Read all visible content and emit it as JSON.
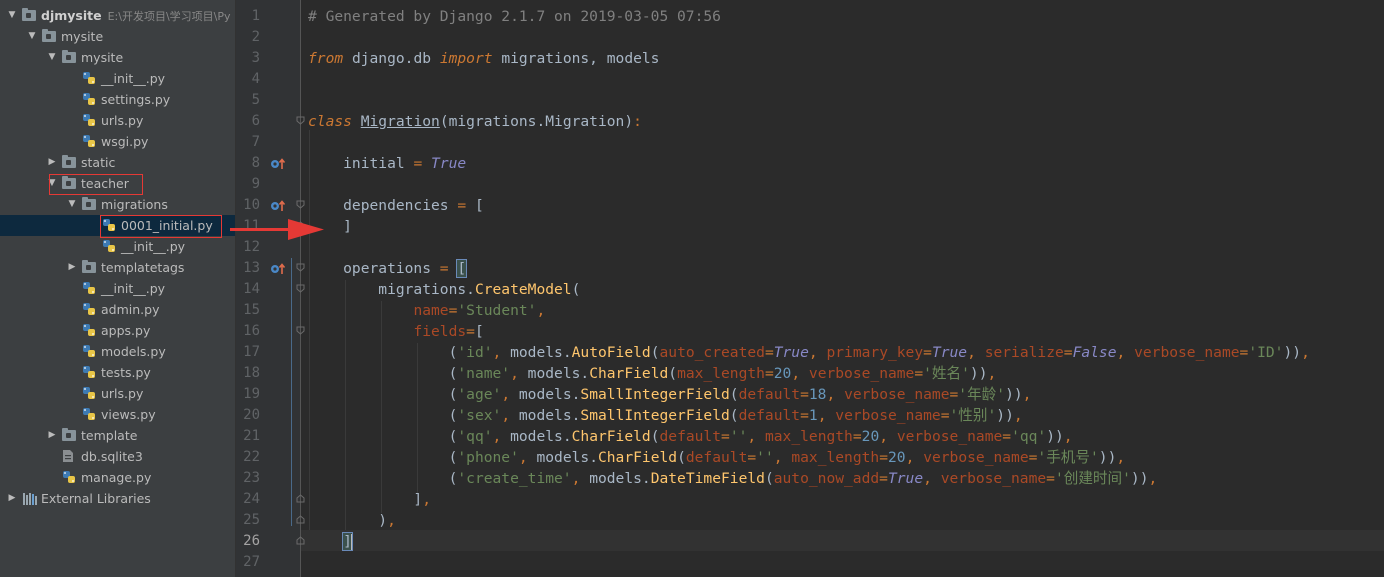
{
  "project_tree": {
    "rows": [
      {
        "label": "djmysite",
        "hint": "E:\\开发项目\\学习项目\\Py",
        "icon": "folder-icon",
        "expanded": true
      },
      {
        "label": "mysite",
        "icon": "folder-icon",
        "expanded": true
      },
      {
        "label": "mysite",
        "icon": "folder-icon",
        "expanded": true
      },
      {
        "label": "__init__.py",
        "icon": "python-file-icon"
      },
      {
        "label": "settings.py",
        "icon": "python-file-icon"
      },
      {
        "label": "urls.py",
        "icon": "python-file-icon"
      },
      {
        "label": "wsgi.py",
        "icon": "python-file-icon"
      },
      {
        "label": "static",
        "icon": "folder-icon",
        "expanded": false
      },
      {
        "label": "teacher",
        "icon": "folder-icon",
        "expanded": true,
        "highlighted": true
      },
      {
        "label": "migrations",
        "icon": "folder-icon",
        "expanded": true
      },
      {
        "label": "0001_initial.py",
        "icon": "python-file-icon",
        "selected": true,
        "highlighted": true
      },
      {
        "label": "__init__.py",
        "icon": "python-file-icon"
      },
      {
        "label": "templatetags",
        "icon": "folder-icon",
        "expanded": false
      },
      {
        "label": "__init__.py",
        "icon": "python-file-icon"
      },
      {
        "label": "admin.py",
        "icon": "python-file-icon"
      },
      {
        "label": "apps.py",
        "icon": "python-file-icon"
      },
      {
        "label": "models.py",
        "icon": "python-file-icon"
      },
      {
        "label": "tests.py",
        "icon": "python-file-icon"
      },
      {
        "label": "urls.py",
        "icon": "python-file-icon"
      },
      {
        "label": "views.py",
        "icon": "python-file-icon"
      },
      {
        "label": "template",
        "icon": "folder-icon",
        "expanded": false
      },
      {
        "label": "db.sqlite3",
        "icon": "database-file-icon"
      },
      {
        "label": "manage.py",
        "icon": "python-file-icon"
      },
      {
        "label": "External Libraries",
        "icon": "library-icon",
        "expanded": false
      }
    ]
  },
  "editor": {
    "current_line": 26,
    "annotation_color": "#e53935",
    "lines": [
      {
        "n": "1",
        "tokens": [
          [
            "c-com",
            "# Generated by Django 2.1.7 on 2019-03-05 07:56"
          ]
        ]
      },
      {
        "n": "2",
        "tokens": []
      },
      {
        "n": "3",
        "tokens": [
          [
            "c-kwi",
            "from"
          ],
          [
            "c-pl",
            " django.db "
          ],
          [
            "c-kwi",
            "import"
          ],
          [
            "c-pl",
            " migrations, models"
          ]
        ]
      },
      {
        "n": "4",
        "tokens": []
      },
      {
        "n": "5",
        "tokens": []
      },
      {
        "n": "6",
        "tokens": [
          [
            "c-kwi",
            "class"
          ],
          [
            "c-pl",
            " "
          ],
          [
            "c-cls",
            "Migration"
          ],
          [
            "c-pl",
            "(migrations.Migration)"
          ],
          [
            "c-kw",
            ":"
          ]
        ]
      },
      {
        "n": "7",
        "tokens": []
      },
      {
        "n": "8",
        "tokens": [
          [
            "c-pl",
            "    initial "
          ],
          [
            "c-kw",
            "="
          ],
          [
            "c-pl",
            " "
          ],
          [
            "c-bool",
            "True"
          ]
        ]
      },
      {
        "n": "9",
        "tokens": []
      },
      {
        "n": "10",
        "tokens": [
          [
            "c-pl",
            "    dependencies "
          ],
          [
            "c-kw",
            "="
          ],
          [
            "c-pl",
            " ["
          ]
        ]
      },
      {
        "n": "11",
        "tokens": [
          [
            "c-pl",
            "    ]"
          ]
        ]
      },
      {
        "n": "12",
        "tokens": []
      },
      {
        "n": "13",
        "tokens": [
          [
            "c-pl",
            "    operations "
          ],
          [
            "c-kw",
            "="
          ],
          [
            "c-pl",
            " "
          ],
          [
            "brace",
            "["
          ]
        ]
      },
      {
        "n": "14",
        "tokens": [
          [
            "c-pl",
            "        migrations."
          ],
          [
            "c-fn",
            "CreateModel"
          ],
          [
            "c-pl",
            "("
          ]
        ]
      },
      {
        "n": "15",
        "tokens": [
          [
            "c-pl",
            "            "
          ],
          [
            "c-prm",
            "name"
          ],
          [
            "c-kw",
            "="
          ],
          [
            "c-str",
            "'Student'"
          ],
          [
            "c-kw",
            ","
          ]
        ]
      },
      {
        "n": "16",
        "tokens": [
          [
            "c-pl",
            "            "
          ],
          [
            "c-prm",
            "fields"
          ],
          [
            "c-kw",
            "="
          ],
          [
            "c-pl",
            "["
          ]
        ]
      },
      {
        "n": "17",
        "tokens": [
          [
            "c-pl",
            "                ("
          ],
          [
            "c-str",
            "'id'"
          ],
          [
            "c-kw",
            ","
          ],
          [
            "c-pl",
            " models."
          ],
          [
            "c-fn",
            "AutoField"
          ],
          [
            "c-pl",
            "("
          ],
          [
            "c-prm",
            "auto_created"
          ],
          [
            "c-kw",
            "="
          ],
          [
            "c-bool",
            "True"
          ],
          [
            "c-kw",
            ","
          ],
          [
            "c-pl",
            " "
          ],
          [
            "c-prm",
            "primary_key"
          ],
          [
            "c-kw",
            "="
          ],
          [
            "c-bool",
            "True"
          ],
          [
            "c-kw",
            ","
          ],
          [
            "c-pl",
            " "
          ],
          [
            "c-prm",
            "serialize"
          ],
          [
            "c-kw",
            "="
          ],
          [
            "c-bool",
            "False"
          ],
          [
            "c-kw",
            ","
          ],
          [
            "c-pl",
            " "
          ],
          [
            "c-prm",
            "verbose_name"
          ],
          [
            "c-kw",
            "="
          ],
          [
            "c-str",
            "'ID'"
          ],
          [
            "c-pl",
            "))"
          ],
          [
            "c-kw",
            ","
          ]
        ]
      },
      {
        "n": "18",
        "tokens": [
          [
            "c-pl",
            "                ("
          ],
          [
            "c-str",
            "'name'"
          ],
          [
            "c-kw",
            ","
          ],
          [
            "c-pl",
            " models."
          ],
          [
            "c-fn",
            "CharField"
          ],
          [
            "c-pl",
            "("
          ],
          [
            "c-prm",
            "max_length"
          ],
          [
            "c-kw",
            "="
          ],
          [
            "c-num",
            "20"
          ],
          [
            "c-kw",
            ","
          ],
          [
            "c-pl",
            " "
          ],
          [
            "c-prm",
            "verbose_name"
          ],
          [
            "c-kw",
            "="
          ],
          [
            "c-str",
            "'姓名'"
          ],
          [
            "c-pl",
            "))"
          ],
          [
            "c-kw",
            ","
          ]
        ]
      },
      {
        "n": "19",
        "tokens": [
          [
            "c-pl",
            "                ("
          ],
          [
            "c-str",
            "'age'"
          ],
          [
            "c-kw",
            ","
          ],
          [
            "c-pl",
            " models."
          ],
          [
            "c-fn",
            "SmallIntegerField"
          ],
          [
            "c-pl",
            "("
          ],
          [
            "c-prm",
            "default"
          ],
          [
            "c-kw",
            "="
          ],
          [
            "c-num",
            "18"
          ],
          [
            "c-kw",
            ","
          ],
          [
            "c-pl",
            " "
          ],
          [
            "c-prm",
            "verbose_name"
          ],
          [
            "c-kw",
            "="
          ],
          [
            "c-str",
            "'年龄'"
          ],
          [
            "c-pl",
            "))"
          ],
          [
            "c-kw",
            ","
          ]
        ]
      },
      {
        "n": "20",
        "tokens": [
          [
            "c-pl",
            "                ("
          ],
          [
            "c-str",
            "'sex'"
          ],
          [
            "c-kw",
            ","
          ],
          [
            "c-pl",
            " models."
          ],
          [
            "c-fn",
            "SmallIntegerField"
          ],
          [
            "c-pl",
            "("
          ],
          [
            "c-prm",
            "default"
          ],
          [
            "c-kw",
            "="
          ],
          [
            "c-num",
            "1"
          ],
          [
            "c-kw",
            ","
          ],
          [
            "c-pl",
            " "
          ],
          [
            "c-prm",
            "verbose_name"
          ],
          [
            "c-kw",
            "="
          ],
          [
            "c-str",
            "'性别'"
          ],
          [
            "c-pl",
            "))"
          ],
          [
            "c-kw",
            ","
          ]
        ]
      },
      {
        "n": "21",
        "tokens": [
          [
            "c-pl",
            "                ("
          ],
          [
            "c-str",
            "'qq'"
          ],
          [
            "c-kw",
            ","
          ],
          [
            "c-pl",
            " models."
          ],
          [
            "c-fn",
            "CharField"
          ],
          [
            "c-pl",
            "("
          ],
          [
            "c-prm",
            "default"
          ],
          [
            "c-kw",
            "="
          ],
          [
            "c-str",
            "''"
          ],
          [
            "c-kw",
            ","
          ],
          [
            "c-pl",
            " "
          ],
          [
            "c-prm",
            "max_length"
          ],
          [
            "c-kw",
            "="
          ],
          [
            "c-num",
            "20"
          ],
          [
            "c-kw",
            ","
          ],
          [
            "c-pl",
            " "
          ],
          [
            "c-prm",
            "verbose_name"
          ],
          [
            "c-kw",
            "="
          ],
          [
            "c-str",
            "'qq'"
          ],
          [
            "c-pl",
            "))"
          ],
          [
            "c-kw",
            ","
          ]
        ]
      },
      {
        "n": "22",
        "tokens": [
          [
            "c-pl",
            "                ("
          ],
          [
            "c-str",
            "'phone'"
          ],
          [
            "c-kw",
            ","
          ],
          [
            "c-pl",
            " models."
          ],
          [
            "c-fn",
            "CharField"
          ],
          [
            "c-pl",
            "("
          ],
          [
            "c-prm",
            "default"
          ],
          [
            "c-kw",
            "="
          ],
          [
            "c-str",
            "''"
          ],
          [
            "c-kw",
            ","
          ],
          [
            "c-pl",
            " "
          ],
          [
            "c-prm",
            "max_length"
          ],
          [
            "c-kw",
            "="
          ],
          [
            "c-num",
            "20"
          ],
          [
            "c-kw",
            ","
          ],
          [
            "c-pl",
            " "
          ],
          [
            "c-prm",
            "verbose_name"
          ],
          [
            "c-kw",
            "="
          ],
          [
            "c-str",
            "'手机号'"
          ],
          [
            "c-pl",
            "))"
          ],
          [
            "c-kw",
            ","
          ]
        ]
      },
      {
        "n": "23",
        "tokens": [
          [
            "c-pl",
            "                ("
          ],
          [
            "c-str",
            "'create_time'"
          ],
          [
            "c-kw",
            ","
          ],
          [
            "c-pl",
            " models."
          ],
          [
            "c-fn",
            "DateTimeField"
          ],
          [
            "c-pl",
            "("
          ],
          [
            "c-prm",
            "auto_now_add"
          ],
          [
            "c-kw",
            "="
          ],
          [
            "c-bool",
            "True"
          ],
          [
            "c-kw",
            ","
          ],
          [
            "c-pl",
            " "
          ],
          [
            "c-prm",
            "verbose_name"
          ],
          [
            "c-kw",
            "="
          ],
          [
            "c-str",
            "'创建时间'"
          ],
          [
            "c-pl",
            "))"
          ],
          [
            "c-kw",
            ","
          ]
        ]
      },
      {
        "n": "24",
        "tokens": [
          [
            "c-pl",
            "            ]"
          ],
          [
            "c-kw",
            ","
          ]
        ]
      },
      {
        "n": "25",
        "tokens": [
          [
            "c-pl",
            "        )"
          ],
          [
            "c-kw",
            ","
          ]
        ]
      },
      {
        "n": "26",
        "tokens": [
          [
            "c-pl",
            "    "
          ],
          [
            "brace",
            "]"
          ],
          [
            "caret",
            ""
          ]
        ]
      },
      {
        "n": "27",
        "tokens": []
      }
    ]
  }
}
